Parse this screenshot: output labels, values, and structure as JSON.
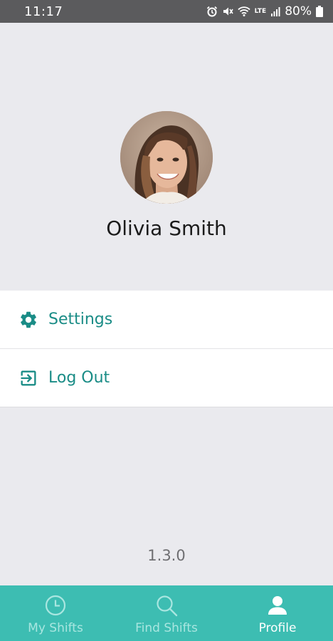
{
  "status_bar": {
    "time": "11:17",
    "battery": "80%",
    "network": "LTE",
    "icons": [
      "alarm-icon",
      "mute-icon",
      "wifi-icon",
      "lte-icon",
      "signal-icon",
      "battery-icon"
    ]
  },
  "profile": {
    "name": "Olivia Smith"
  },
  "menu": {
    "items": [
      {
        "label": "Settings",
        "icon": "gear-icon"
      },
      {
        "label": "Log Out",
        "icon": "logout-icon"
      }
    ]
  },
  "version": "1.3.0",
  "bottom_nav": {
    "items": [
      {
        "label": "My Shifts",
        "icon": "clock-icon",
        "active": false
      },
      {
        "label": "Find Shifts",
        "icon": "search-icon",
        "active": false
      },
      {
        "label": "Profile",
        "icon": "person-icon",
        "active": true
      }
    ]
  },
  "colors": {
    "accent": "#1a8c86",
    "nav_background": "#3dbdb2",
    "status_bar": "#5b5b5d",
    "page_background": "#eaeaee"
  }
}
